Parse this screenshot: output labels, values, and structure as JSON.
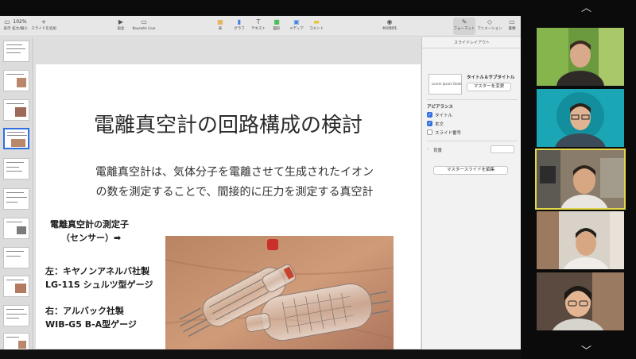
{
  "toolbar": {
    "zoom": "102%",
    "items": [
      {
        "name": "view-button",
        "icon": "▭",
        "label": "表示"
      },
      {
        "name": "zoom-button",
        "icon": "102%",
        "label": "拡大/縮小"
      },
      {
        "name": "add-slide-button",
        "icon": "+",
        "label": "スライドを追加"
      },
      {
        "name": "play-button",
        "icon": "▶",
        "label": "再生"
      },
      {
        "name": "keynote-live-button",
        "icon": "▭",
        "label": "Keynote Live"
      },
      {
        "name": "table-button",
        "icon": "▦",
        "label": "表"
      },
      {
        "name": "chart-button",
        "icon": "▮",
        "label": "グラフ"
      },
      {
        "name": "text-button",
        "icon": "T",
        "label": "テキスト"
      },
      {
        "name": "shape-button",
        "icon": "■",
        "label": "図形"
      },
      {
        "name": "media-button",
        "icon": "▣",
        "label": "メディア"
      },
      {
        "name": "comment-button",
        "icon": "▬",
        "label": "コメント"
      },
      {
        "name": "collaborate-button",
        "icon": "◉",
        "label": "共同制作"
      },
      {
        "name": "format-button",
        "icon": "✎",
        "label": "フォーマット"
      },
      {
        "name": "animate-button",
        "icon": "◇",
        "label": "アニメーション"
      },
      {
        "name": "document-button",
        "icon": "▭",
        "label": "書類"
      }
    ]
  },
  "slide": {
    "title": "電離真空計の回路構成の検討",
    "body_line1": "電離真空計は、気体分子を電離させて生成されたイオン",
    "body_line2": "の数を測定することで、間接的に圧力を測定する真空計",
    "caption1_line1": "電離真空計の測定子",
    "caption1_line2": "（センサー）➡",
    "caption2_line1": "左：キヤノンアネルバ社製",
    "caption2_line2": "LG-11S シュルツ型ゲージ",
    "caption3_line1": "右：アルバック社製",
    "caption3_line2": "WIB-G5 B-A型ゲージ"
  },
  "inspector": {
    "header": "スライドレイアウト",
    "layout_name": "タイトル＆サブタイトル",
    "master_thumb_text": "Lorem Ipsum Dolor",
    "change_master_button": "マスターを変更",
    "appearance_label": "アピアランス",
    "checkboxes": [
      {
        "label": "タイトル",
        "checked": true
      },
      {
        "label": "本文",
        "checked": true
      },
      {
        "label": "スライド番号",
        "checked": false
      }
    ],
    "background_label": "背景",
    "edit_master_button": "マスタースライドを編集"
  },
  "colors": {
    "accent": "#2f6fe0",
    "active_speaker": "#e3d84a"
  }
}
